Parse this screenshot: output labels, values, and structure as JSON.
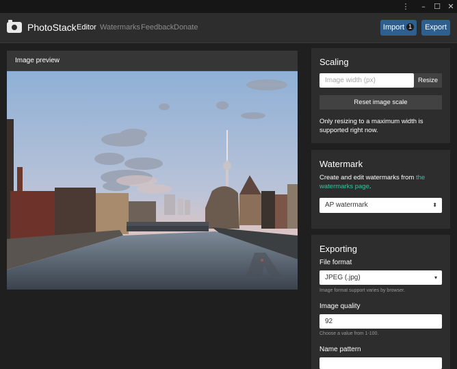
{
  "window": {
    "menu_icon": "⋮",
    "min_icon": "–",
    "max_icon": "☐",
    "close_icon": "✕"
  },
  "app": {
    "brand": "PhotoStack",
    "nav": [
      "Editor",
      "Watermarks",
      "Feedback",
      "Donate"
    ],
    "import_label": "Import",
    "import_count": "1",
    "export_label": "Export"
  },
  "preview": {
    "title": "Image preview"
  },
  "scaling": {
    "title": "Scaling",
    "width_placeholder": "Image width (px)",
    "resize_label": "Resize",
    "reset_label": "Reset image scale",
    "note": "Only resizing to a maximum width is supported right now."
  },
  "watermark": {
    "title": "Watermark",
    "desc_prefix": "Create and edit watermarks from ",
    "link_text": "the watermarks page",
    "desc_suffix": ".",
    "selected": "AP watermark"
  },
  "exporting": {
    "title": "Exporting",
    "format_label": "File format",
    "format_value": "JPEG (.jpg)",
    "format_hint": "Image format support varies by browser.",
    "quality_label": "Image quality",
    "quality_value": "92",
    "quality_hint": "Choose a value from 1-100.",
    "name_label": "Name pattern",
    "name_value": ""
  },
  "colors": {
    "accent_blue": "#2e5f8f",
    "link_green": "#3fc29c",
    "panel_bg": "#2d2d2d"
  }
}
